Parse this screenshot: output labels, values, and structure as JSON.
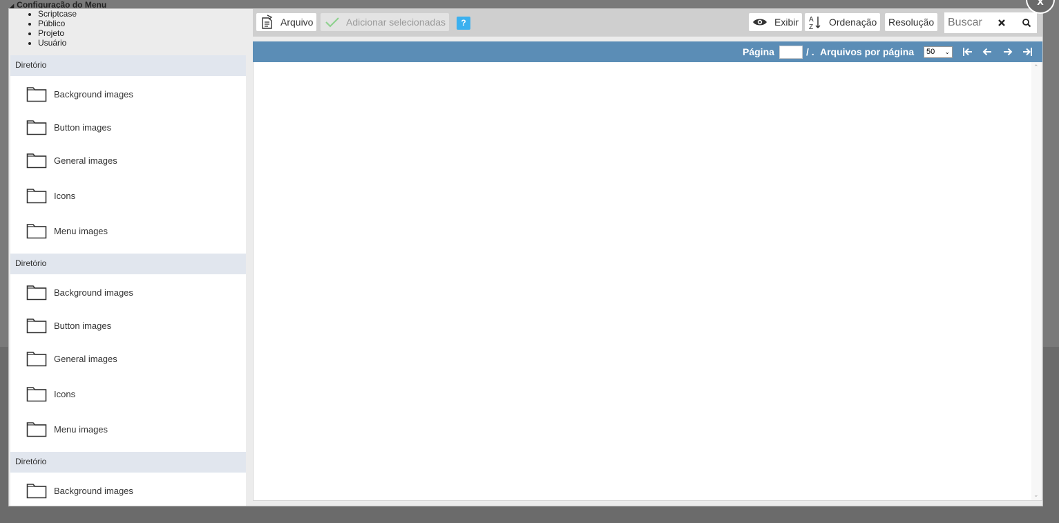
{
  "background": {
    "title": "Configuração do Menu"
  },
  "tree": {
    "items": [
      "Scriptcase",
      "Público",
      "Projeto",
      "Usuário"
    ]
  },
  "directories": [
    {
      "header": "Diretório",
      "items": [
        "Background images",
        "Button images",
        "General images",
        "Icons",
        "Menu images"
      ]
    },
    {
      "header": "Diretório",
      "items": [
        "Background images",
        "Button images",
        "General images",
        "Icons",
        "Menu images"
      ]
    },
    {
      "header": "Diretório",
      "items": [
        "Background images"
      ]
    }
  ],
  "toolbar": {
    "arquivo": "Arquivo",
    "adicionar": "Adicionar selecionadas",
    "help": "?",
    "exibir": "Exibir",
    "ordenacao": "Ordenação",
    "resolucao": "Resolução",
    "search_placeholder": "Buscar"
  },
  "pager": {
    "page_label": "Página",
    "separator": "/ .",
    "per_page_label": "Arquivos por página",
    "per_page_value": "50"
  },
  "close_label": "x",
  "colors": {
    "pager_bg": "#5b8db6",
    "help_bg": "#3bb0ef",
    "dir_header_bg": "#e1e6ee"
  }
}
